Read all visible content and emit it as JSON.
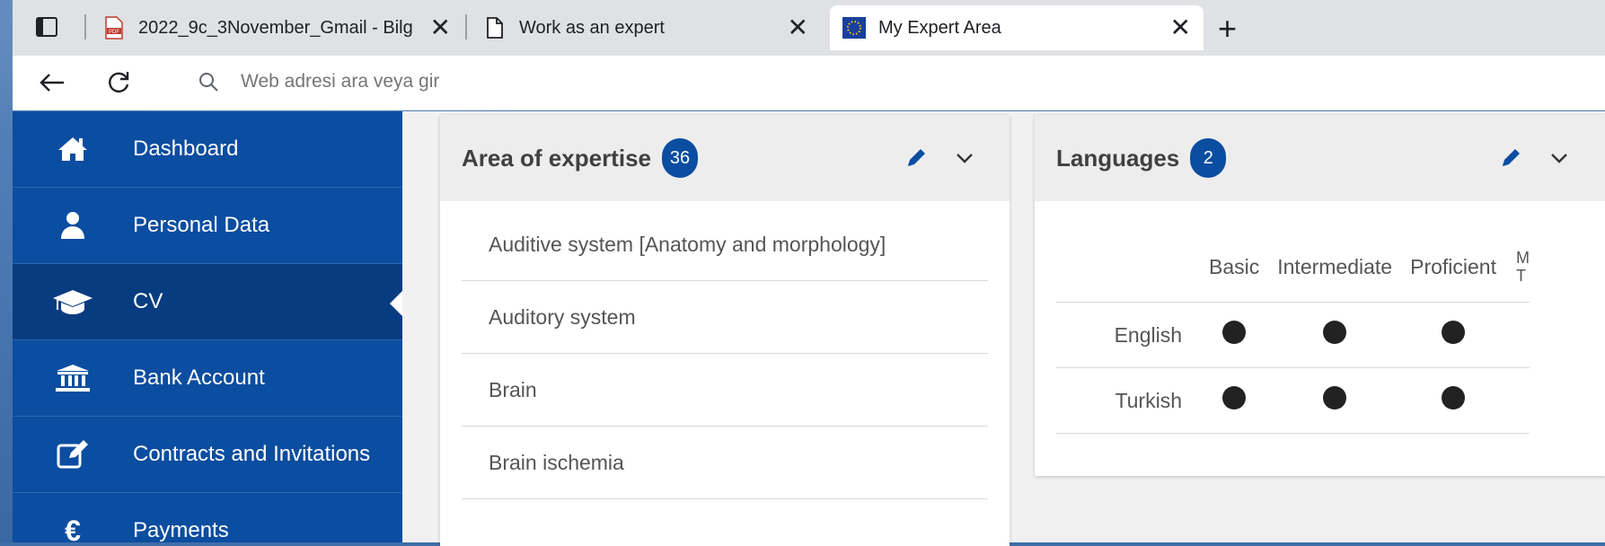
{
  "browser": {
    "tabs": [
      {
        "title": "2022_9c_3November_Gmail - Bilg",
        "favicon": "pdf-icon"
      },
      {
        "title": "Work as an expert",
        "favicon": "document-icon"
      },
      {
        "title": "My Expert Area",
        "favicon": "eu-flag-icon",
        "active": true
      }
    ],
    "address_placeholder": "Web adresi ara veya gir"
  },
  "sidebar": {
    "items": [
      {
        "label": "Dashboard",
        "icon": "home-icon"
      },
      {
        "label": "Personal Data",
        "icon": "user-icon"
      },
      {
        "label": "CV",
        "icon": "graduation-cap-icon",
        "active": true
      },
      {
        "label": "Bank Account",
        "icon": "bank-icon"
      },
      {
        "label": "Contracts and Invitations",
        "icon": "edit-icon"
      },
      {
        "label": "Payments",
        "icon": "euro-icon"
      }
    ]
  },
  "expertise": {
    "title": "Area of expertise",
    "count": "36",
    "items": [
      "Auditive system [Anatomy and morphology]",
      "Auditory system",
      "Brain",
      "Brain ischemia"
    ]
  },
  "languages": {
    "title": "Languages",
    "count": "2",
    "columns": [
      "Basic",
      "Intermediate",
      "Proficient",
      "M\nT"
    ],
    "rows": [
      {
        "name": "English",
        "levels": [
          true,
          true,
          true
        ]
      },
      {
        "name": "Turkish",
        "levels": [
          true,
          true,
          true
        ]
      }
    ]
  },
  "colors": {
    "primary": "#0b4da0",
    "primary_dark": "#083c80",
    "header_gray": "#ededed"
  }
}
